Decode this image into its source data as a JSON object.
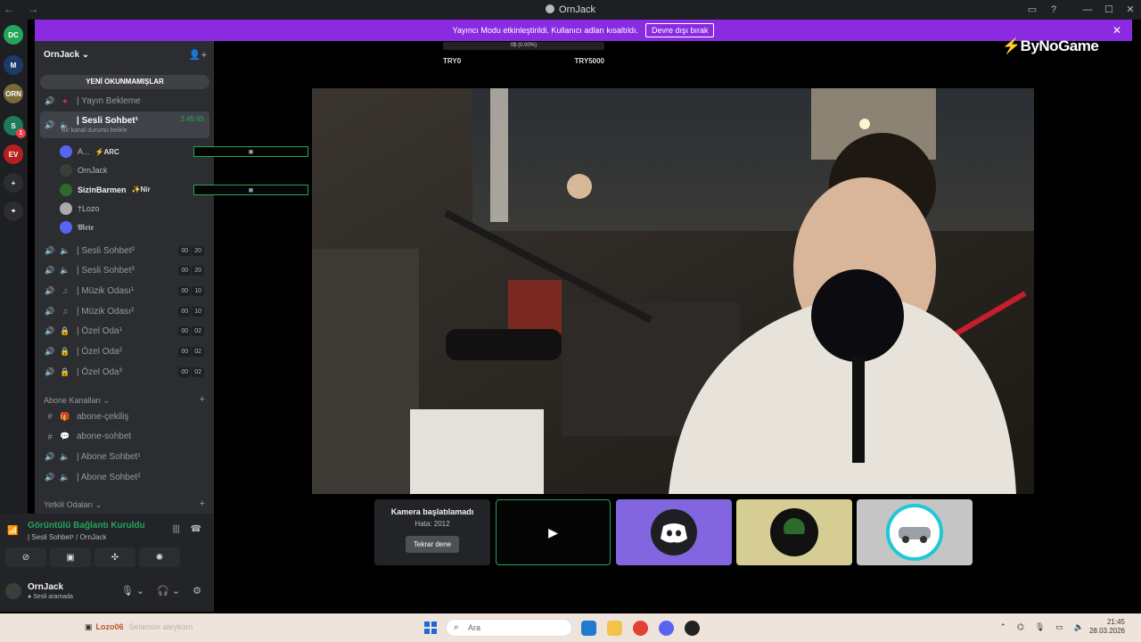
{
  "window": {
    "title": "OrnJack",
    "controls": [
      "minimize",
      "maximize",
      "close"
    ]
  },
  "banner": {
    "message": "Yayıncı Modu etkinleştirildi. Kullanıcı adları kısaltıldı.",
    "button": "Devre dışı bırak",
    "color": "#8a2be2"
  },
  "servers": [
    {
      "label": "DC",
      "color": "#23a55a"
    },
    {
      "label": "M",
      "color": "#1b3a6b"
    },
    {
      "label": "ORN",
      "color": "#7a6a3a"
    },
    {
      "label": "S",
      "color": "#1f7a5a",
      "badge": "1"
    },
    {
      "label": "EV",
      "color": "#b81e1e"
    },
    {
      "label": "+",
      "color": "#2b2d31"
    },
    {
      "label": "⌖",
      "color": "#2b2d31"
    }
  ],
  "sidebar": {
    "guild_name": "OrnJack",
    "unread_button": "YENİ OKUNMAMIŞLAR",
    "channels": [
      {
        "name": "| Yayın Bekleme"
      },
      {
        "name": "| Sesli Sohbet¹",
        "timer": "3:45:45",
        "sub": "Bir kanal durumu belirle"
      },
      {
        "name": "| Sesli Sohbet²",
        "count": [
          "00",
          "20"
        ]
      },
      {
        "name": "| Sesli Sohbet³",
        "count": [
          "00",
          "20"
        ]
      },
      {
        "name": "| Müzik Odası¹",
        "count": [
          "00",
          "10"
        ]
      },
      {
        "name": "| Müzik Odası²",
        "count": [
          "00",
          "10"
        ]
      },
      {
        "name": "| Özel Oda¹",
        "count": [
          "00",
          "02"
        ]
      },
      {
        "name": "| Özel Oda²",
        "count": [
          "00",
          "02"
        ]
      },
      {
        "name": "| Özel Oda³",
        "count": [
          "00",
          "02"
        ]
      }
    ],
    "voice_users": [
      {
        "name": "A...",
        "tag": "⚡ARC"
      },
      {
        "name": "OrnJack",
        "tag": ""
      },
      {
        "name": "SizinBarmen",
        "tag": "✨Nir"
      },
      {
        "name": "†Lozo",
        "tag": ""
      },
      {
        "name": "𝕸𝖊𝖙𝖊",
        "tag": ""
      }
    ],
    "categories": [
      "Abone Kanalları",
      "Yetkili Odaları"
    ],
    "sub_channels": [
      {
        "name": "abone-çekiliş"
      },
      {
        "name": "abone-sohbet"
      },
      {
        "name": "| Abone Sohbet¹"
      },
      {
        "name": "| Abone Sohbet²"
      }
    ]
  },
  "voice_panel": {
    "status": "Görüntülü Bağlantı Kuruldu",
    "channel": "| Sesli Sohbet¹ / OrnJack"
  },
  "user_panel": {
    "name": "OrnJack",
    "status": "Sesli aramada"
  },
  "stream": {
    "progress_text": "0$ (0.00%)",
    "goal_start": "TRY0",
    "goal_end": "TRY5000",
    "brand": "ByNoGame",
    "camera_error": {
      "title": "Kamera başlatılamadı",
      "code": "Hata: 2012",
      "retry": "Tekrar dene"
    }
  },
  "taskbar": {
    "widget_user": "Lozo06",
    "widget_text": "Selamün aleyküm",
    "search_placeholder": "Ara",
    "time": "21:45",
    "date": "28.03.2026"
  }
}
